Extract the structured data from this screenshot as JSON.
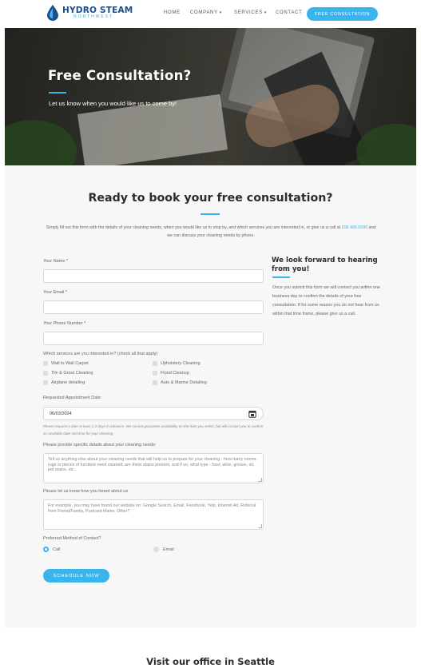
{
  "brand": {
    "name": "HYDRO STEAM",
    "tagline": "NORTHWEST"
  },
  "nav": {
    "home": "HOME",
    "company": "COMPANY",
    "services": "SERVICES",
    "contact": "CONTACT",
    "cta": "FREE CONSULTATION"
  },
  "hero": {
    "title": "Free Consultation?",
    "subtitle": "Let us know when you would like us to come by!"
  },
  "section": {
    "title": "Ready to book your free consultation?",
    "intro_before": "Simply fill out this form with the details of your cleaning needs, when you would like us to stop by, and which services you are interested in, or give us a call at ",
    "phone": "206.406.6590",
    "intro_after": " and we can discuss your cleaning needs by phone."
  },
  "form": {
    "name_label": "Your Name *",
    "email_label": "Your Email *",
    "phone_label": "Your Phone Number *",
    "services_label": "Which services are you interested in? (check all that apply)",
    "services": [
      "Wall to Wall Carpet",
      "Upholstery Cleaning",
      "Tile & Grout Cleaning",
      "Flood Cleanup",
      "Airplane detailing",
      "Auto & Marine Detailing"
    ],
    "date_label": "Requested Appointment Date:",
    "date_value": "06/03/2024",
    "date_note": "Please request a date at least 1-2 days in advance. We cannot guarantee availability on the date you select, but will contact you to confirm an available date and time for your cleaning.",
    "details_label": "Please provide specific details about your cleaning needs:",
    "details_placeholder": "Tell us anything else about your cleaning needs that will help us to prepare for your cleaning - how many rooms, rugs or pieces of furniture need cleaned; are there stains present, and if so, what type - food, wine, grease, oil, pet stains, etc.:",
    "heard_label": "Please let us know how you heard about us",
    "heard_placeholder": "For example, you may have found our website on: Google Search, Email, Facebook, Yelp, Internet Ad, Referral from Friend/Family, Postcard Mailer, Other?",
    "contact_label": "Preferred Method of Contact?",
    "contact_options": [
      "Call",
      "Email"
    ],
    "submit": "SCHEDULE NOW"
  },
  "aside": {
    "title": "We look forward to hearing from you!",
    "text": "Once you submit this form we will contact you within one business day to confirm the details of your free consultation. If for some reason you do not hear from us within that time frame, please give us a call."
  },
  "footer_section": {
    "title": "Visit our office in Seattle"
  },
  "colors": {
    "accent": "#3ab4ec",
    "brand": "#1a4f8b"
  },
  "icons": {
    "logo": "water-drop-icon",
    "calendar": "calendar-icon",
    "caret": "chevron-down-icon"
  }
}
